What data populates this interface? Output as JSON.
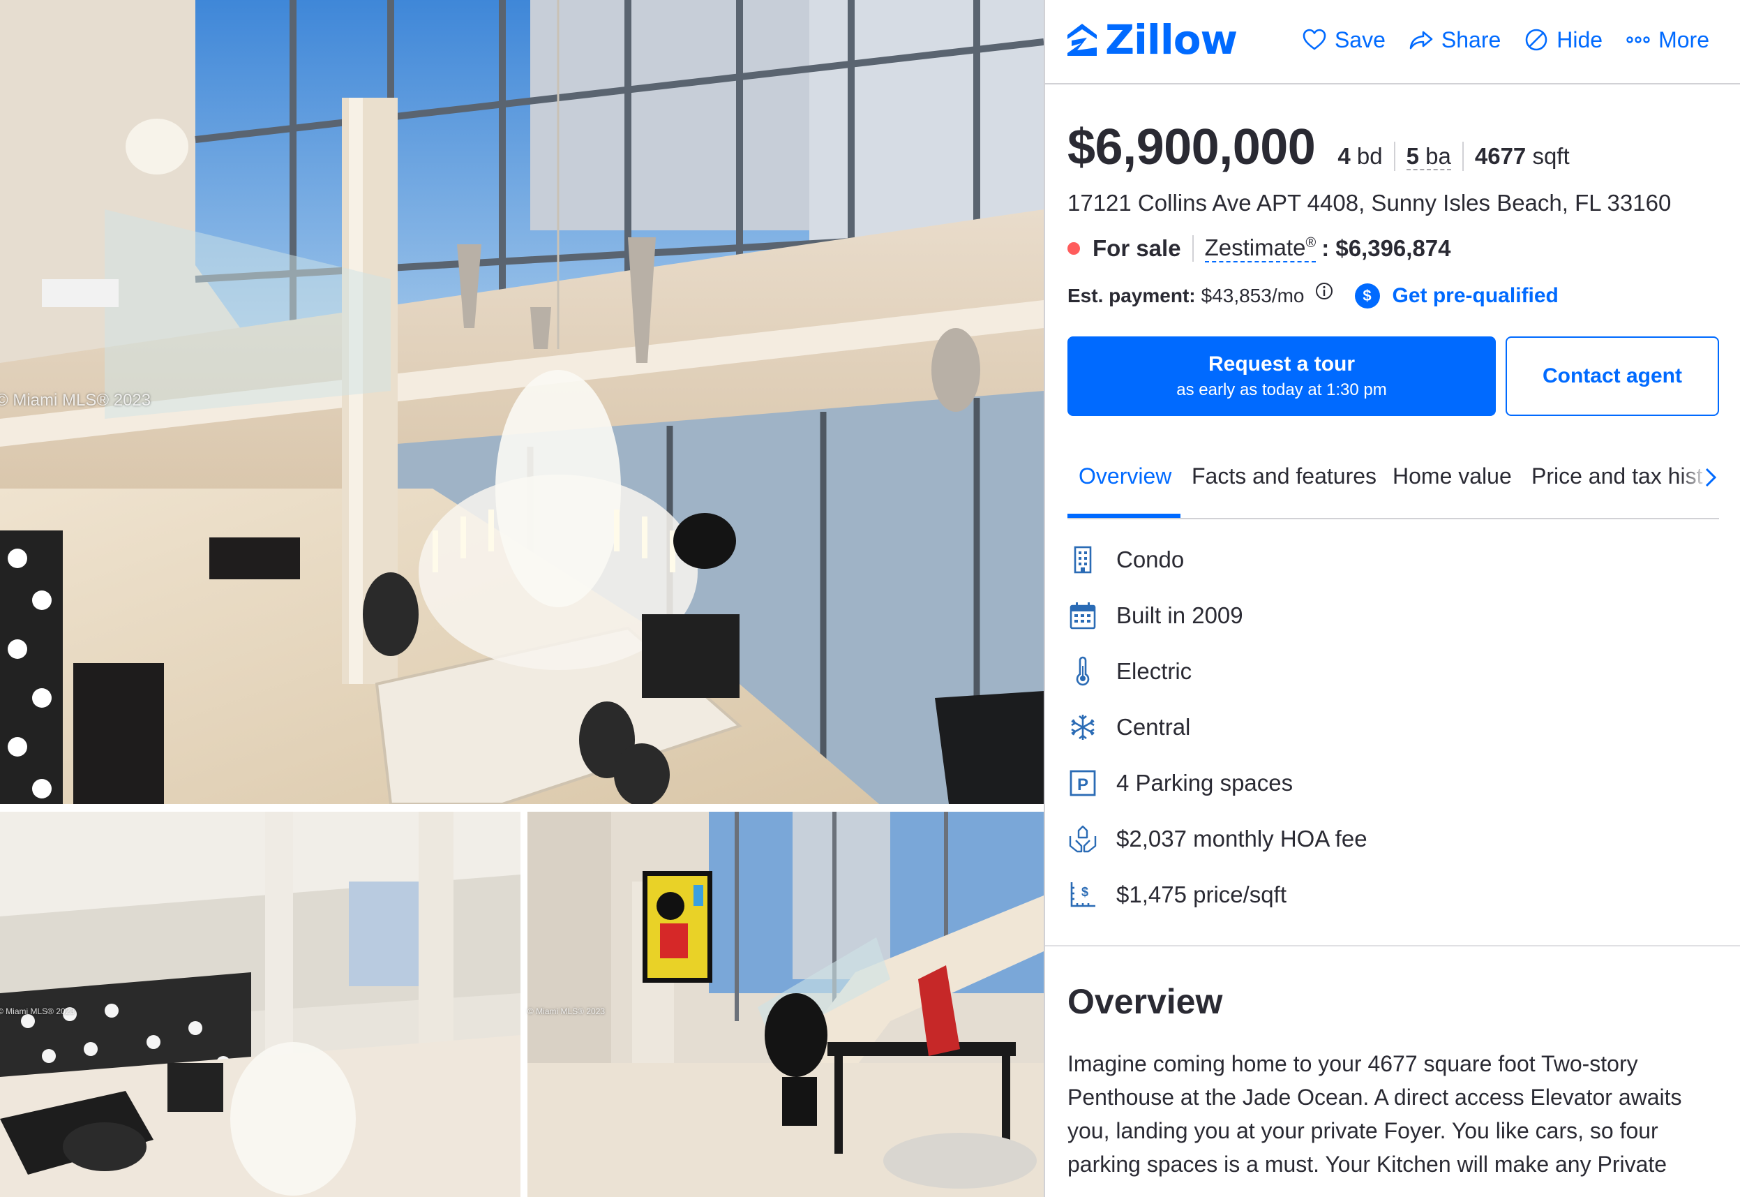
{
  "gallery": {
    "watermark": "© Miami MLS® 2023",
    "watermark_small": "© Miami MLS® 2023"
  },
  "header": {
    "logo_text": "Zillow",
    "actions": [
      {
        "label": "Save",
        "icon": "heart-icon"
      },
      {
        "label": "Share",
        "icon": "share-icon"
      },
      {
        "label": "Hide",
        "icon": "hide-icon"
      },
      {
        "label": "More",
        "icon": "more-icon"
      }
    ]
  },
  "listing": {
    "price": "$6,900,000",
    "beds_value": "4",
    "beds_unit": "bd",
    "baths_value": "5",
    "baths_unit": "ba",
    "sqft_value": "4677",
    "sqft_unit": "sqft",
    "address": "17121 Collins Ave APT 4408, Sunny Isles Beach, FL 33160",
    "status": "For sale",
    "zestimate_label": "Zestimate",
    "zestimate_mark": "®",
    "zestimate_value": ": $6,396,874",
    "payment_label": "Est. payment:",
    "payment_value": "$43,853/mo",
    "prequalified": "Get pre-qualified",
    "status_color": "#ff5c5c"
  },
  "buttons": {
    "tour_title": "Request a tour",
    "tour_sub": "as early as today at 1:30 pm",
    "contact": "Contact agent"
  },
  "tabs": [
    {
      "label": "Overview",
      "active": true
    },
    {
      "label": "Facts and features",
      "active": false
    },
    {
      "label": "Home value",
      "active": false
    },
    {
      "label": "Price and tax hist",
      "active": false
    }
  ],
  "features": [
    {
      "label": "Condo",
      "icon": "building-icon"
    },
    {
      "label": "Built in 2009",
      "icon": "calendar-icon"
    },
    {
      "label": "Electric",
      "icon": "thermometer-icon"
    },
    {
      "label": "Central",
      "icon": "snowflake-icon"
    },
    {
      "label": "4 Parking spaces",
      "icon": "parking-icon"
    },
    {
      "label": "$2,037 monthly HOA fee",
      "icon": "hoa-hands-icon"
    },
    {
      "label": "$1,475 price/sqft",
      "icon": "price-sqft-icon"
    }
  ],
  "overview": {
    "title": "Overview",
    "text": "Imagine coming home to your 4677 square foot Two-story Penthouse at the Jade Ocean. A direct access Elevator awaits you, landing you at your private Foyer. You like cars, so four parking spaces is a must. Your Kitchen will make any Private"
  },
  "colors": {
    "brand": "#006aff",
    "text": "#2a2a33",
    "divider": "#d1d1d5"
  }
}
